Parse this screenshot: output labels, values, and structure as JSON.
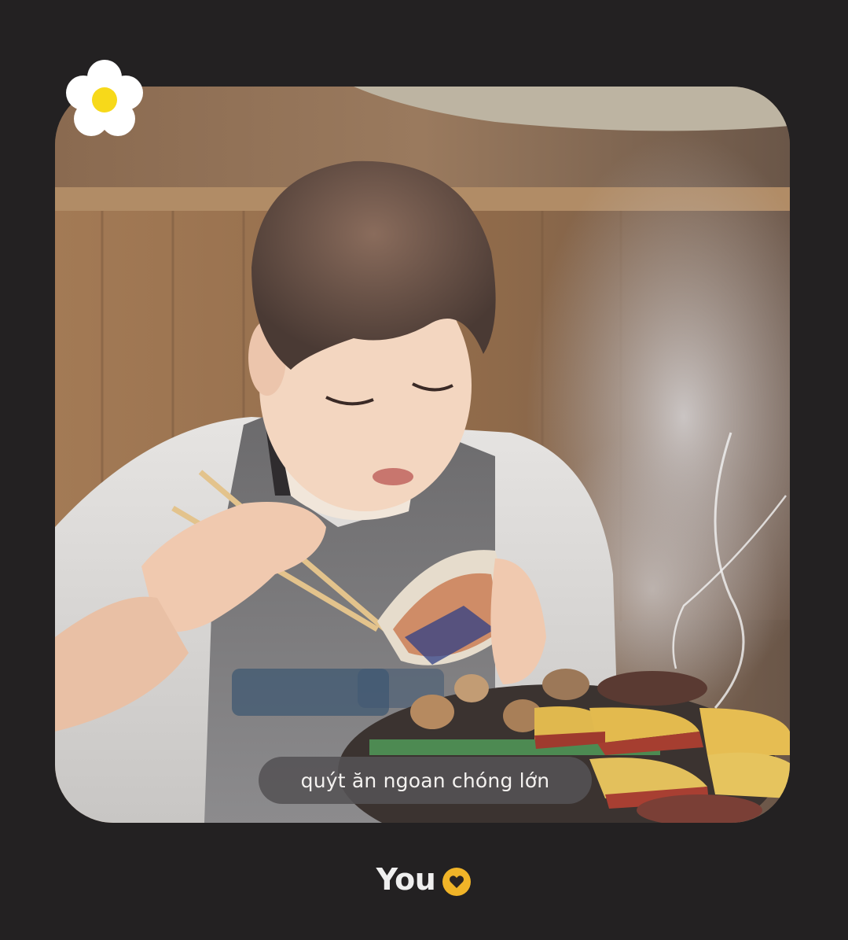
{
  "story": {
    "caption": "quýt ăn ngoan chóng lớn",
    "author": "You",
    "sticker_icon": "daisy-flower-icon",
    "badge_icon": "heart-badge-icon"
  },
  "colors": {
    "background": "#232122",
    "caption_pill": "#545254",
    "caption_text": "#f4f2f0",
    "author_text": "#efefef",
    "badge": "#f0b428"
  }
}
